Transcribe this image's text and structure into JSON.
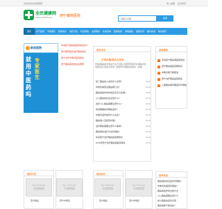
{
  "topbar": {
    "left": "欢迎来到全民健康网",
    "right1": "加入收藏",
    "right2": "设为首页"
  },
  "header": {
    "logo_title": "全民健康网",
    "logo_url": "www.qmh120.com",
    "site_name": "西宁癫痫医院",
    "search_placeholder": "请输入内容",
    "search_button": "搜索"
  },
  "nav": [
    "首页",
    "关于医院",
    "专家团队",
    "疾病常识",
    "治疗方法",
    "科室导航",
    "患者服务",
    "在线咨询",
    "医院新闻",
    "来院路线",
    "健康资讯",
    "图片新闻",
    "联系我们"
  ],
  "ad": {
    "logo": "新采医院",
    "line1": "就",
    "line2": "用",
    "line3": "中",
    "line4": "医",
    "line5": "药",
    "line6": "吗",
    "big": "专家医生"
  },
  "links": [
    "青海西宁癫痫病医院电话多少",
    "西宁哪家医院治疗癫痫病好",
    "西宁治疗羊角风医院排名",
    "西宁癫痫医院地址在哪里"
  ],
  "news": {
    "title": "医院动态",
    "headline": "羊角疯癫痫能否痊愈",
    "summary": "羊角疯癫痫的出现多与生活习惯以及遗传因素有关,癫痫患者需要注意日常生活中的一些细节才能很好的康复...[详情]",
    "items": [
      {
        "t": "·得了癫痫的人会有什么表现?",
        "d": "06-01"
      },
      {
        "t": "·羊角风病因主要由哪几点?",
        "d": "06-01"
      },
      {
        "t": "·癫痫病发作的时候应该怎么处理?",
        "d": "06-01"
      },
      {
        "t": "·小儿癫痫的饮食注意什么?",
        "d": "06-01"
      },
      {
        "t": "·治疗小儿癫痫需要注意什么?",
        "d": "06-01"
      },
      {
        "t": "·青春期癫痫有哪些症状?",
        "d": "06-01"
      },
      {
        "t": "·羊角风发作前有什么先兆?",
        "d": "06-01"
      },
      {
        "t": "·癫痫病人该如何护理?",
        "d": "06-01"
      },
      {
        "t": "·治疗癫痫需要注意什么事项?",
        "d": "06-01"
      },
      {
        "t": "·癫痫病的治疗方法有哪些?",
        "d": "06-01"
      },
      {
        "t": "·青海西宁治疗癫痫医院哪家好",
        "d": "06-01"
      },
      {
        "t": "·2019年西宁治疗癫痫病医院排名",
        "d": "06-01"
      }
    ]
  },
  "videos": {
    "title": "视频推荐",
    "items": [
      "青海西宁癫痫病医院电话",
      "西宁癫痫病医院哪家好",
      "羊角风能不能根治",
      "西宁治疗癫痫医院排名",
      "儿童癫痫病早期症状有哪些"
    ]
  },
  "sections": [
    {
      "title": "癫痫问答",
      "pics": [
        "西宁癫痫",
        "西宁羊角疯"
      ]
    },
    {
      "title": "癫痫症状",
      "pics": [
        "西宁癫痫",
        "西宁羊角疯"
      ]
    }
  ],
  "nopic": {
    "a": "No Picture",
    "b": "无缩略图"
  },
  "recommend": {
    "title": "推荐阅读",
    "items": [
      "癫痫病的常见症状有哪些?",
      "羊角风的病因有哪些?",
      "癫痫病发作的急救方法",
      "小儿癫痫需要注意什么",
      "成人癫痫的症状表现",
      "癫痫病能不能治好?",
      "西宁治疗癫痫的医院",
      "癫痫病患者饮食禁忌"
    ]
  }
}
